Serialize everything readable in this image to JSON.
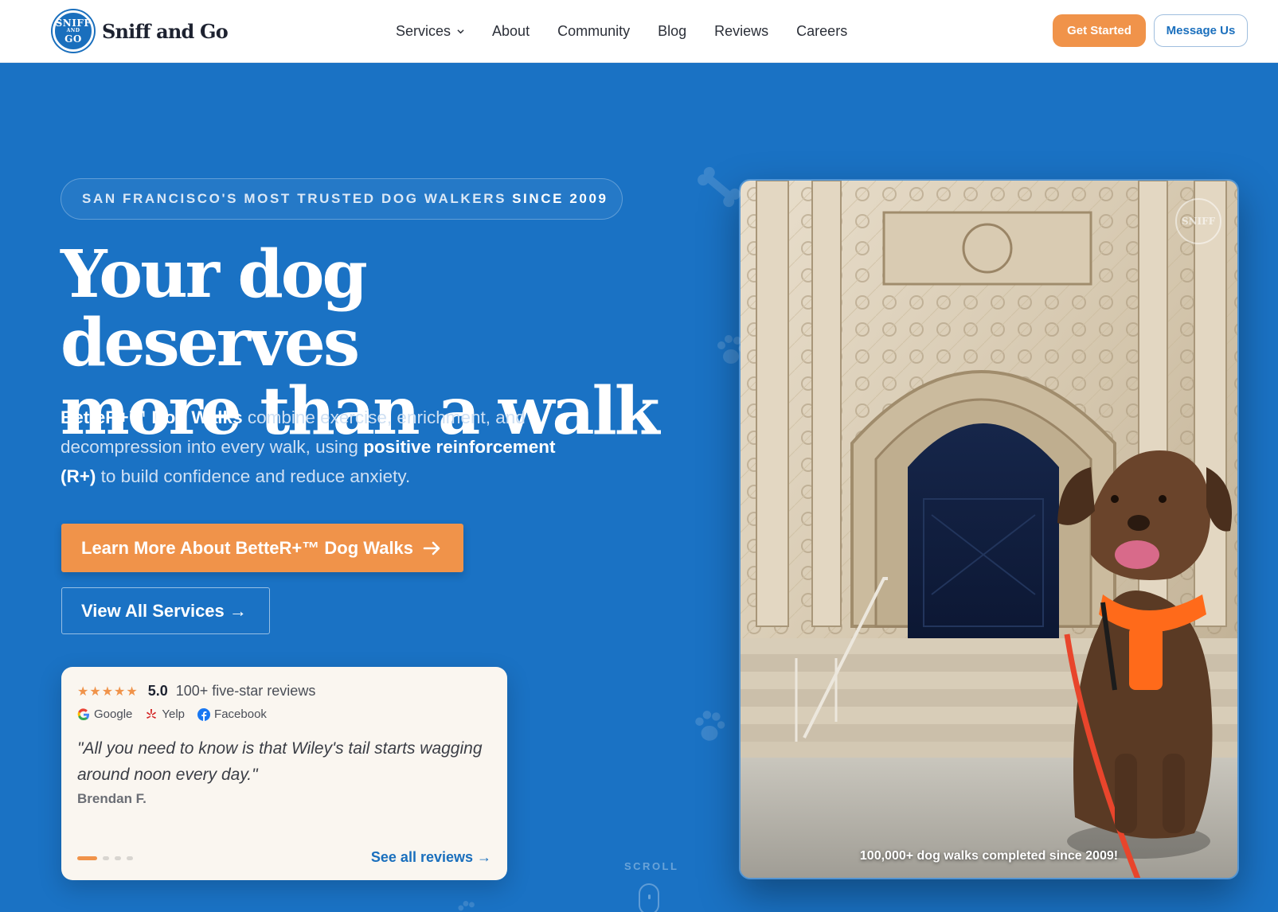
{
  "brand": {
    "name": "Sniff and Go",
    "logo_top": "SNIFF",
    "logo_mid": "AND",
    "logo_bottom": "GO"
  },
  "nav": {
    "items": [
      "Services",
      "About",
      "Community",
      "Blog",
      "Reviews",
      "Careers"
    ],
    "get_started": "Get Started",
    "message_us": "Message Us"
  },
  "hero": {
    "tagline": "SAN FRANCISCO'S MOST TRUSTED DOG WALKERS",
    "tagline_strong": "SINCE 2009",
    "headline_line1": "Your dog deserves",
    "headline_line2": "more than a walk",
    "lead_strong1": "BetteR+™ Dog Walks",
    "lead_text1": " combine exercise, enrichment, and decompression into every walk, using ",
    "lead_strong2": "positive reinforcement (R+)",
    "lead_text2": " to build confidence and reduce anxiety.",
    "cta_primary": "Learn More About BetteR+™ Dog Walks",
    "cta_secondary": "View All Services →"
  },
  "review": {
    "stars": "★★★★★",
    "score": "5.0",
    "count": "100+ five-star reviews",
    "sources": [
      "Google",
      "Yelp",
      "Facebook"
    ],
    "quote": "\"All you need to know is that Wiley's tail starts wagging around noon every day.\"",
    "author": "Brendan F.",
    "see_all": "See all reviews →",
    "active_slide": 1,
    "slide_count": 4
  },
  "scroll": {
    "label": "SCROLL"
  },
  "photo": {
    "caption": "100,000+ dog walks completed since 2009!",
    "watermark": "SNIFF"
  },
  "colors": {
    "hero_bg": "#1a72c4",
    "accent_orange": "#f0934a",
    "brand_blue": "#1a6fbd"
  }
}
